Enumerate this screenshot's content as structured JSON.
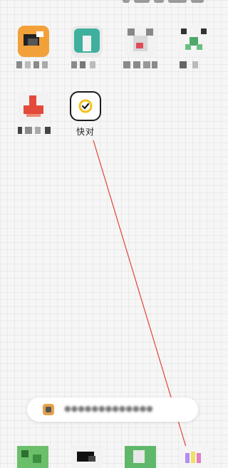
{
  "status_bar": {
    "blurred": true
  },
  "home_screen": {
    "apps": [
      {
        "name": "blurred-app",
        "label": "",
        "icon": "blurred-orange-app-icon"
      },
      {
        "name": "blurred-app",
        "label": "",
        "icon": "blurred-teal-app-icon"
      },
      {
        "name": "blurred-app",
        "label": "",
        "icon": "blurred-grey-app-icon"
      },
      {
        "name": "blurred-app",
        "label": "",
        "icon": "blurred-green-app-icon"
      },
      {
        "name": "blurred-app",
        "label": "",
        "icon": "blurred-red-app-icon"
      },
      {
        "name": "kuaidui",
        "label": "快对",
        "icon": "kuaidui-check-icon"
      }
    ]
  },
  "toast": {
    "icon": "app-small-icon",
    "message": "●●●●●●●●●●●●●",
    "blurred": true
  },
  "dock": {
    "items": 4,
    "blurred": true
  },
  "colors": {
    "background": "#f6f6f6",
    "kuaidui_yellow": "#f1c21b",
    "trace_line": "#e0443a"
  }
}
